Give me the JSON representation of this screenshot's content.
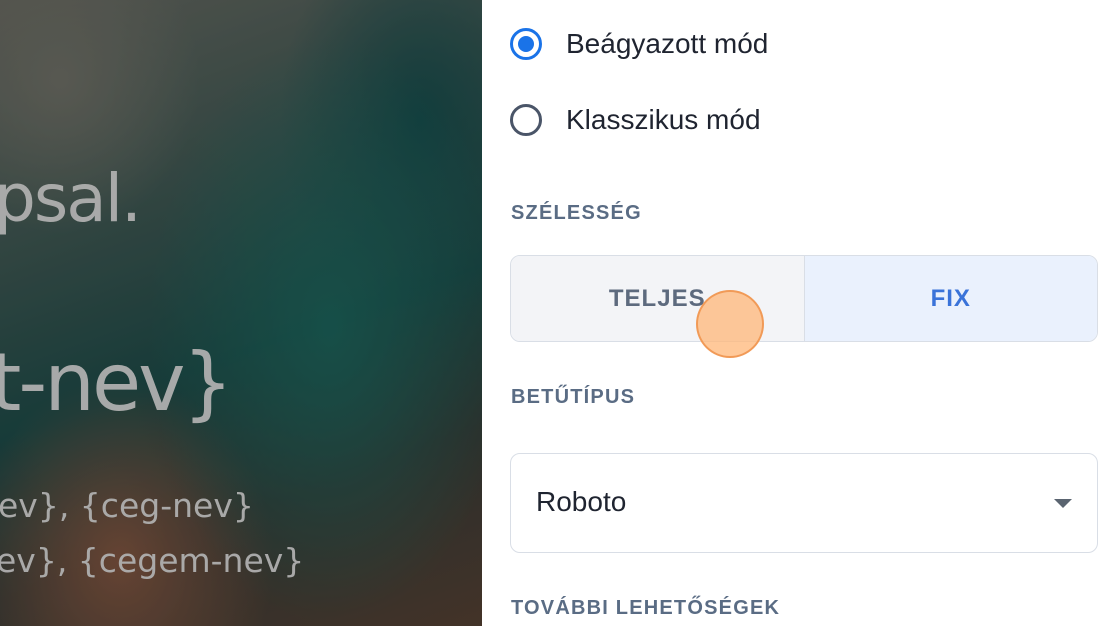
{
  "preview": {
    "line1": "psal.",
    "line2": "t-nev}",
    "line3": "ev}, {ceg-nev}",
    "line4": "ev}, {cegem-nev}"
  },
  "mode": {
    "options": [
      {
        "label": "Beágyazott mód",
        "selected": true
      },
      {
        "label": "Klasszikus mód",
        "selected": false
      }
    ]
  },
  "width": {
    "heading": "SZÉLESSÉG",
    "options": [
      "TELJES",
      "FIX"
    ],
    "selected": "FIX"
  },
  "font": {
    "heading": "BETŰTÍPUS",
    "value": "Roboto"
  },
  "more": {
    "heading": "TOVÁBBI LEHETŐSÉGEK"
  },
  "colors": {
    "accent": "#1a73e8",
    "segment_active_bg": "#eaf1fd",
    "section_label": "#5a6c84"
  }
}
